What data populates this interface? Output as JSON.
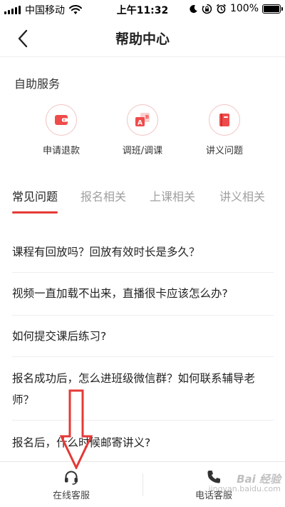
{
  "status_bar": {
    "carrier": "中国移动",
    "time": "上午11:32",
    "battery_text": "100%",
    "battery_level": 1.0,
    "icons": [
      "signal-icon",
      "wifi-icon",
      "moon-icon",
      "lock-rotation-icon",
      "alarm-icon",
      "battery-icon"
    ]
  },
  "nav": {
    "title": "帮助中心",
    "back_icon": "chevron-left-icon"
  },
  "self_service": {
    "title": "自助服务",
    "items": [
      {
        "label": "申请退款",
        "icon": "wallet-icon"
      },
      {
        "label": "调班/调课",
        "icon": "swap-class-icon"
      },
      {
        "label": "讲义问题",
        "icon": "book-icon"
      }
    ]
  },
  "tabs": {
    "items": [
      "常见问题",
      "报名相关",
      "上课相关",
      "讲义相关"
    ],
    "active_index": 0
  },
  "faq": [
    "课程有回放吗？回放有效时长是多久？",
    "视频一直加载不出来，直播很卡应该怎么办?",
    "如何提交课后练习?",
    "报名成功后，怎么进班级微信群？如何联系辅导老师？",
    "报名后，什么时候邮寄讲义?"
  ],
  "bottom_bar": {
    "online_service": "在线客服",
    "phone_service": "电话客服",
    "online_icon": "headset-icon",
    "phone_icon": "phone-icon"
  },
  "annotation": {
    "arrow_color": "#e53935",
    "arrow_icon": "down-arrow-icon"
  },
  "watermark": {
    "line1": "Bai 经验",
    "line2": "jingyan.baidu.com"
  },
  "colors": {
    "accent": "#e53935",
    "tab_inactive": "#a0a0a0",
    "divider": "#eeeeee"
  }
}
